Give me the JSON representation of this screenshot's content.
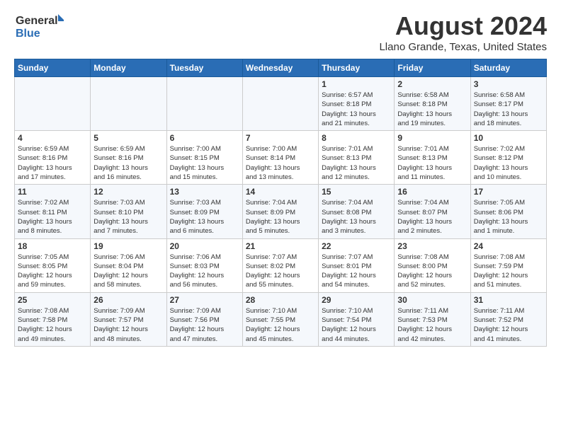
{
  "header": {
    "logo_general": "General",
    "logo_blue": "Blue",
    "title": "August 2024",
    "location": "Llano Grande, Texas, United States"
  },
  "days_of_week": [
    "Sunday",
    "Monday",
    "Tuesday",
    "Wednesday",
    "Thursday",
    "Friday",
    "Saturday"
  ],
  "weeks": [
    [
      {
        "day": "",
        "info": ""
      },
      {
        "day": "",
        "info": ""
      },
      {
        "day": "",
        "info": ""
      },
      {
        "day": "",
        "info": ""
      },
      {
        "day": "1",
        "info": "Sunrise: 6:57 AM\nSunset: 8:18 PM\nDaylight: 13 hours\nand 21 minutes."
      },
      {
        "day": "2",
        "info": "Sunrise: 6:58 AM\nSunset: 8:18 PM\nDaylight: 13 hours\nand 19 minutes."
      },
      {
        "day": "3",
        "info": "Sunrise: 6:58 AM\nSunset: 8:17 PM\nDaylight: 13 hours\nand 18 minutes."
      }
    ],
    [
      {
        "day": "4",
        "info": "Sunrise: 6:59 AM\nSunset: 8:16 PM\nDaylight: 13 hours\nand 17 minutes."
      },
      {
        "day": "5",
        "info": "Sunrise: 6:59 AM\nSunset: 8:16 PM\nDaylight: 13 hours\nand 16 minutes."
      },
      {
        "day": "6",
        "info": "Sunrise: 7:00 AM\nSunset: 8:15 PM\nDaylight: 13 hours\nand 15 minutes."
      },
      {
        "day": "7",
        "info": "Sunrise: 7:00 AM\nSunset: 8:14 PM\nDaylight: 13 hours\nand 13 minutes."
      },
      {
        "day": "8",
        "info": "Sunrise: 7:01 AM\nSunset: 8:13 PM\nDaylight: 13 hours\nand 12 minutes."
      },
      {
        "day": "9",
        "info": "Sunrise: 7:01 AM\nSunset: 8:13 PM\nDaylight: 13 hours\nand 11 minutes."
      },
      {
        "day": "10",
        "info": "Sunrise: 7:02 AM\nSunset: 8:12 PM\nDaylight: 13 hours\nand 10 minutes."
      }
    ],
    [
      {
        "day": "11",
        "info": "Sunrise: 7:02 AM\nSunset: 8:11 PM\nDaylight: 13 hours\nand 8 minutes."
      },
      {
        "day": "12",
        "info": "Sunrise: 7:03 AM\nSunset: 8:10 PM\nDaylight: 13 hours\nand 7 minutes."
      },
      {
        "day": "13",
        "info": "Sunrise: 7:03 AM\nSunset: 8:09 PM\nDaylight: 13 hours\nand 6 minutes."
      },
      {
        "day": "14",
        "info": "Sunrise: 7:04 AM\nSunset: 8:09 PM\nDaylight: 13 hours\nand 5 minutes."
      },
      {
        "day": "15",
        "info": "Sunrise: 7:04 AM\nSunset: 8:08 PM\nDaylight: 13 hours\nand 3 minutes."
      },
      {
        "day": "16",
        "info": "Sunrise: 7:04 AM\nSunset: 8:07 PM\nDaylight: 13 hours\nand 2 minutes."
      },
      {
        "day": "17",
        "info": "Sunrise: 7:05 AM\nSunset: 8:06 PM\nDaylight: 13 hours\nand 1 minute."
      }
    ],
    [
      {
        "day": "18",
        "info": "Sunrise: 7:05 AM\nSunset: 8:05 PM\nDaylight: 12 hours\nand 59 minutes."
      },
      {
        "day": "19",
        "info": "Sunrise: 7:06 AM\nSunset: 8:04 PM\nDaylight: 12 hours\nand 58 minutes."
      },
      {
        "day": "20",
        "info": "Sunrise: 7:06 AM\nSunset: 8:03 PM\nDaylight: 12 hours\nand 56 minutes."
      },
      {
        "day": "21",
        "info": "Sunrise: 7:07 AM\nSunset: 8:02 PM\nDaylight: 12 hours\nand 55 minutes."
      },
      {
        "day": "22",
        "info": "Sunrise: 7:07 AM\nSunset: 8:01 PM\nDaylight: 12 hours\nand 54 minutes."
      },
      {
        "day": "23",
        "info": "Sunrise: 7:08 AM\nSunset: 8:00 PM\nDaylight: 12 hours\nand 52 minutes."
      },
      {
        "day": "24",
        "info": "Sunrise: 7:08 AM\nSunset: 7:59 PM\nDaylight: 12 hours\nand 51 minutes."
      }
    ],
    [
      {
        "day": "25",
        "info": "Sunrise: 7:08 AM\nSunset: 7:58 PM\nDaylight: 12 hours\nand 49 minutes."
      },
      {
        "day": "26",
        "info": "Sunrise: 7:09 AM\nSunset: 7:57 PM\nDaylight: 12 hours\nand 48 minutes."
      },
      {
        "day": "27",
        "info": "Sunrise: 7:09 AM\nSunset: 7:56 PM\nDaylight: 12 hours\nand 47 minutes."
      },
      {
        "day": "28",
        "info": "Sunrise: 7:10 AM\nSunset: 7:55 PM\nDaylight: 12 hours\nand 45 minutes."
      },
      {
        "day": "29",
        "info": "Sunrise: 7:10 AM\nSunset: 7:54 PM\nDaylight: 12 hours\nand 44 minutes."
      },
      {
        "day": "30",
        "info": "Sunrise: 7:11 AM\nSunset: 7:53 PM\nDaylight: 12 hours\nand 42 minutes."
      },
      {
        "day": "31",
        "info": "Sunrise: 7:11 AM\nSunset: 7:52 PM\nDaylight: 12 hours\nand 41 minutes."
      }
    ]
  ]
}
